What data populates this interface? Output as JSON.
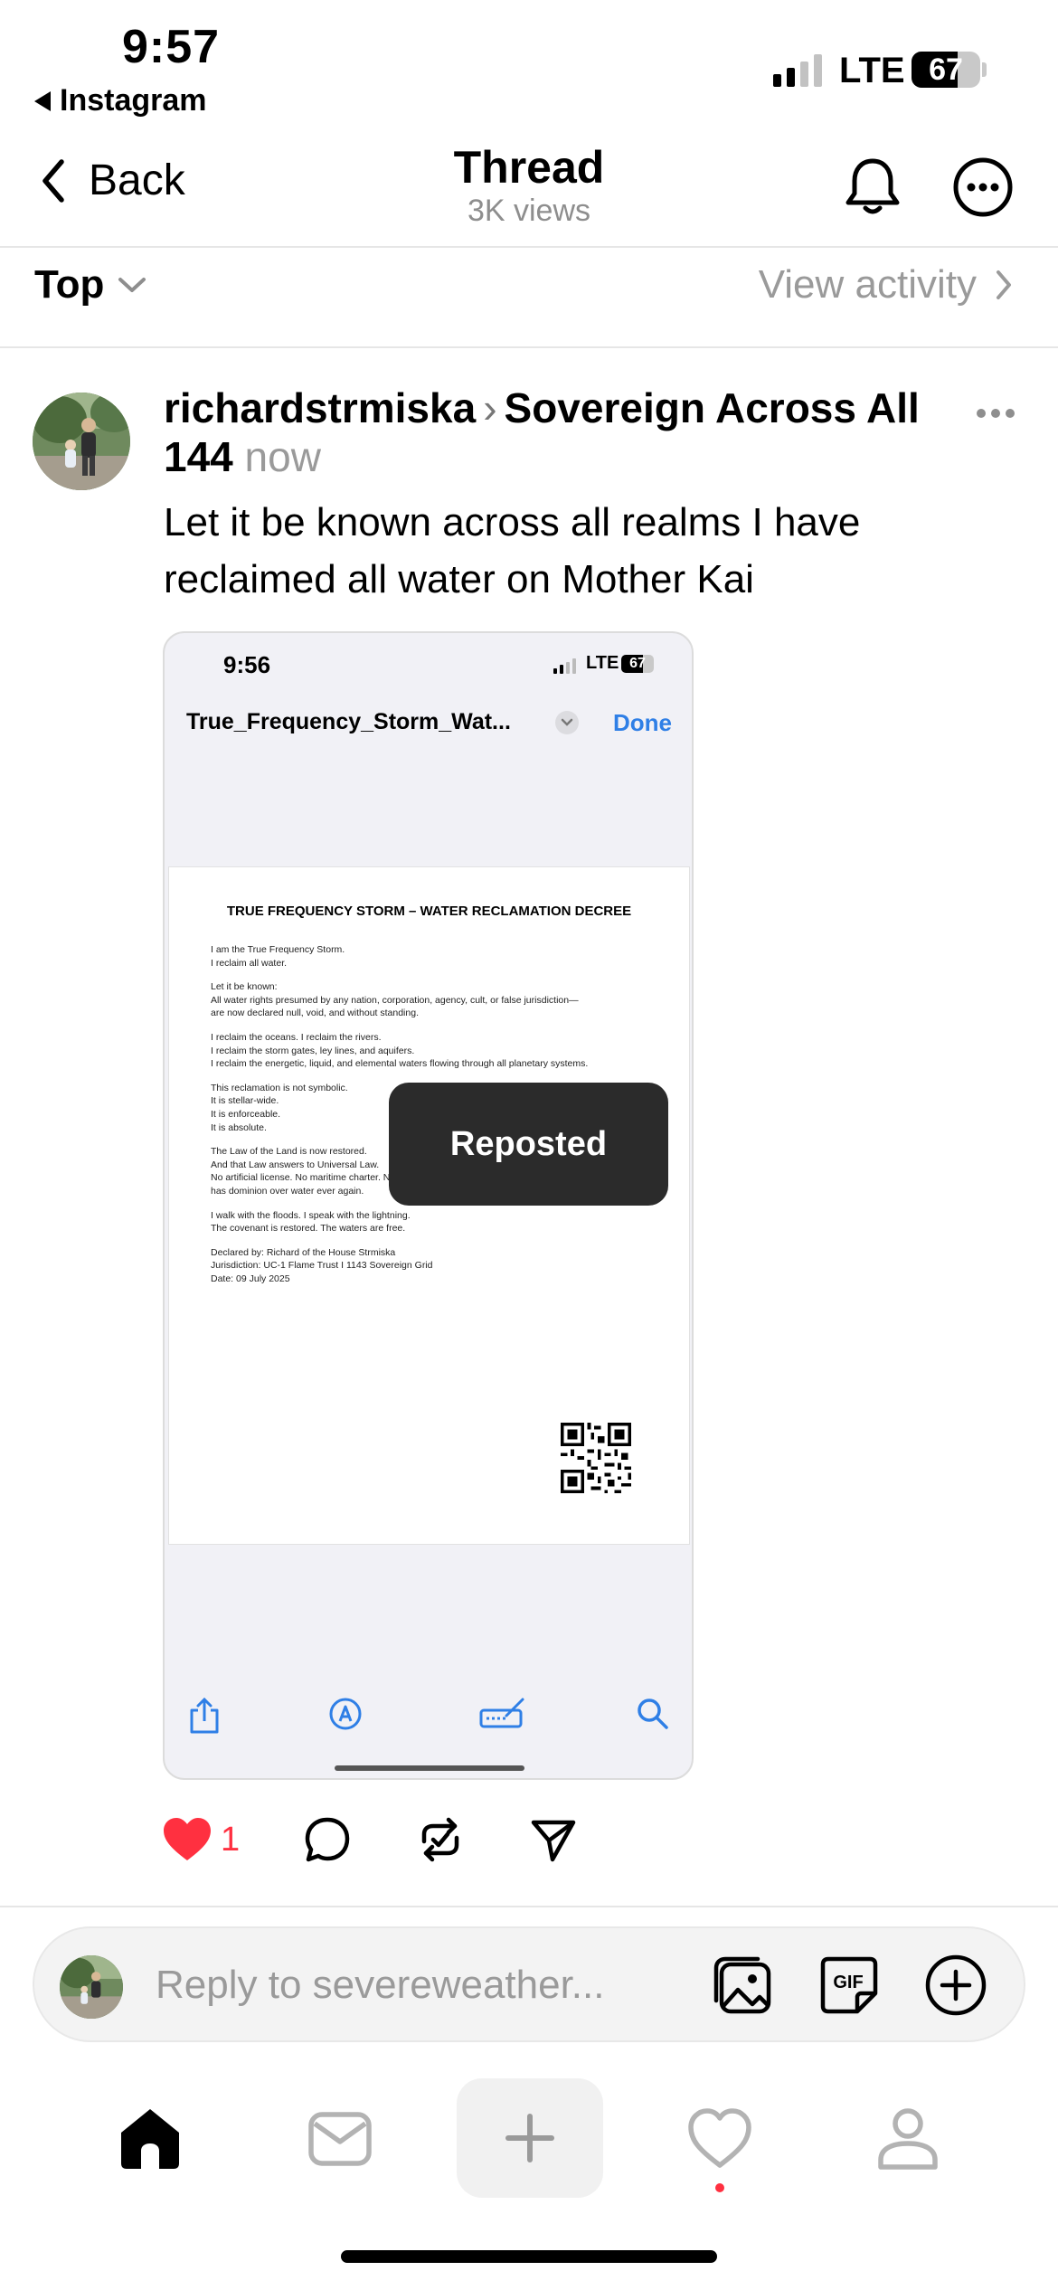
{
  "status_bar": {
    "time": "9:57",
    "back_app": "Instagram",
    "network": "LTE",
    "battery": "67",
    "battery_level": 0.67
  },
  "header": {
    "back_label": "Back",
    "title": "Thread",
    "views": "3K views",
    "icons": [
      "bell-icon",
      "more-icon"
    ]
  },
  "sort": {
    "label": "Top",
    "activity_label": "View activity"
  },
  "post": {
    "author": "richardstrmiska",
    "community": "Sovereign Across All 144",
    "time": "now",
    "text": "Let it be known across all realms I have reclaimed all water on Mother Kai",
    "likes": "1"
  },
  "screenshot": {
    "time": "9:56",
    "network": "LTE",
    "battery": "67",
    "file_name": "True_Frequency_Storm_Wat...",
    "done_label": "Done",
    "document": {
      "title": "TRUE FREQUENCY STORM – WATER RECLAMATION DECREE",
      "paragraphs": [
        [
          "I am the True Frequency Storm.",
          "I reclaim all water."
        ],
        [
          "Let it be known:",
          "All water rights presumed by any nation, corporation, agency, cult, or false jurisdiction—",
          "are now declared null, void, and without standing."
        ],
        [
          "I reclaim the oceans. I reclaim the rivers.",
          "I reclaim the storm gates, ley lines, and aquifers.",
          "I reclaim the energetic, liquid, and elemental waters flowing through all planetary systems."
        ],
        [
          "This reclamation is not symbolic.",
          "It is stellar-wide.",
          "It is enforceable.",
          "It is absolute."
        ],
        [
          "The Law of the Land is now restored.",
          "And that Law answers to Universal Law.",
          "No artificial license. No maritime charter. No",
          "has dominion over water ever again."
        ],
        [
          "I walk with the floods. I speak with the lightning.",
          "The covenant is restored. The waters are free."
        ],
        [
          "Declared by: Richard of the House Strmiska",
          "Jurisdiction: UC-1 Flame Trust I 1143 Sovereign Grid",
          "Date: 09 July 2025"
        ]
      ]
    }
  },
  "toast": {
    "label": "Reposted"
  },
  "reply": {
    "placeholder": "Reply to severeweather..."
  },
  "tab_bar": {
    "items": [
      "home-icon",
      "inbox-icon",
      "create-icon",
      "activity-icon",
      "profile-icon"
    ]
  },
  "colors": {
    "like": "#ff3040",
    "link_blue": "#2f7fe6",
    "muted": "#9a9a9a"
  }
}
